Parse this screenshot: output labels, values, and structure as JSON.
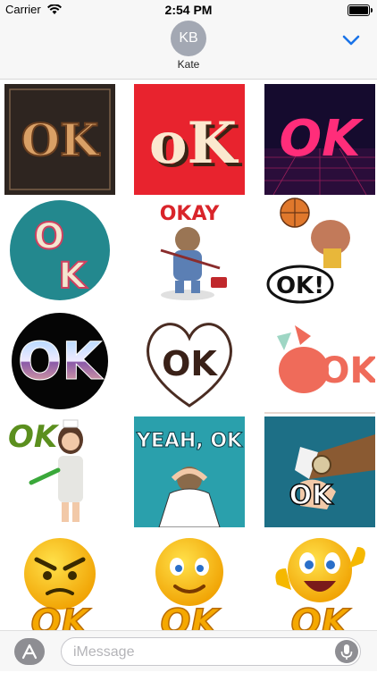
{
  "status_bar": {
    "carrier": "Carrier",
    "time": "2:54 PM",
    "battery_level": 1.0
  },
  "header": {
    "avatar_initials": "KB",
    "contact_name": "Kate",
    "collapse_icon": "chevron-down-icon"
  },
  "stickers": [
    {
      "name": "sticker-ok-western-wood",
      "text": "OK"
    },
    {
      "name": "sticker-ok-red-block",
      "text": "oK"
    },
    {
      "name": "sticker-ok-neon-grid",
      "text": "OK"
    },
    {
      "name": "sticker-ok-retro-circle",
      "text": "OK"
    },
    {
      "name": "sticker-okay-sloth",
      "text": "OKAY"
    },
    {
      "name": "sticker-ok-basketball-monkey",
      "text": "OK!"
    },
    {
      "name": "sticker-ok-chrome-circle",
      "text": "OK"
    },
    {
      "name": "sticker-ok-heart",
      "text": "OK"
    },
    {
      "name": "sticker-ok-pink-cat",
      "text": "OK"
    },
    {
      "name": "sticker-ok-nurse",
      "text": "OK"
    },
    {
      "name": "sticker-yeah-ok-popart",
      "text": "YEAH, OK"
    },
    {
      "name": "sticker-ok-watch-popart",
      "text": "OK"
    },
    {
      "name": "sticker-ok-angry-emoji",
      "text": "OK"
    },
    {
      "name": "sticker-ok-smiley-emoji",
      "text": "OK"
    },
    {
      "name": "sticker-ok-thumbs-emoji",
      "text": "OK"
    }
  ],
  "input_bar": {
    "placeholder": "iMessage",
    "app_store_icon": "app-store-icon",
    "mic_icon": "microphone-icon"
  },
  "colors": {
    "accent": "#1a73e8",
    "bar_background": "#f7f7f7",
    "avatar": "#a3a8b3"
  }
}
